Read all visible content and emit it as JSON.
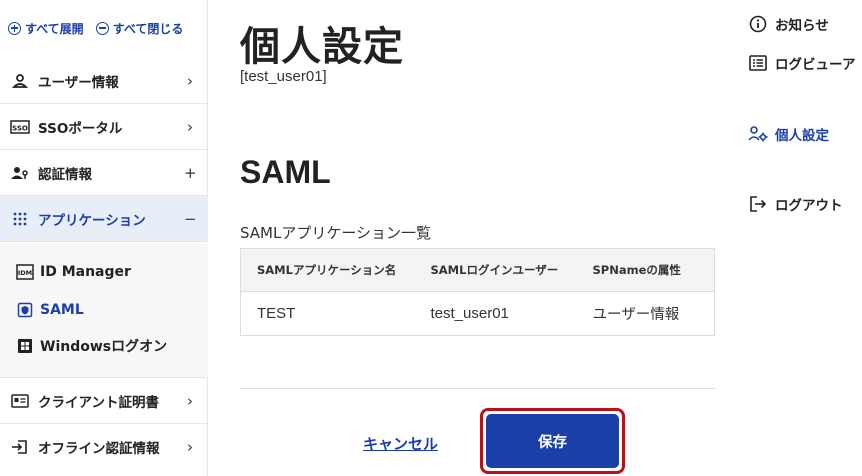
{
  "sidebar": {
    "expand_all": "すべて展開",
    "collapse_all": "すべて閉じる",
    "items": [
      {
        "label": "ユーザー情報",
        "tail": "›"
      },
      {
        "label": "SSOポータル",
        "tail": "›"
      },
      {
        "label": "認証情報",
        "tail": "+"
      },
      {
        "label": "アプリケーション",
        "tail": "−"
      },
      {
        "label": "クライアント証明書",
        "tail": "›"
      },
      {
        "label": "オフライン認証情報",
        "tail": "›"
      }
    ],
    "subitems": [
      {
        "label": "ID Manager"
      },
      {
        "label": "SAML"
      },
      {
        "label": "Windowsログオン"
      }
    ]
  },
  "main": {
    "title": "個人設定",
    "username": "[test_user01]",
    "section_title": "SAML",
    "table_caption": "SAMLアプリケーション一覧",
    "table": {
      "headers": [
        "SAMLアプリケーション名",
        "SAMLログインユーザー",
        "SPNameの属性"
      ],
      "rows": [
        [
          "TEST",
          "test_user01",
          "ユーザー情報"
        ]
      ]
    },
    "cancel_label": "キャンセル",
    "save_label": "保存"
  },
  "right_nav": {
    "items": [
      {
        "label": "お知らせ"
      },
      {
        "label": "ログビューア"
      },
      {
        "label": "個人設定"
      },
      {
        "label": "ログアウト"
      }
    ]
  },
  "colors": {
    "accent": "#1a3fa8",
    "active_background": "#e8eef8",
    "highlight_border": "#b5121b"
  }
}
